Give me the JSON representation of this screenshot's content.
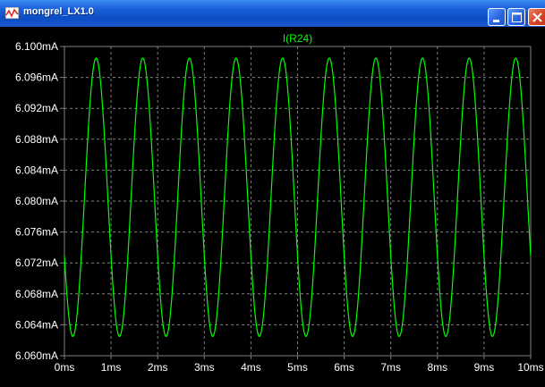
{
  "window": {
    "title": "mongrel_LX1.0",
    "icon": "waveform-icon",
    "buttons": {
      "minimize": "minimize-icon",
      "maximize": "maximize-icon",
      "close": "close-icon"
    }
  },
  "chart_data": {
    "type": "line",
    "title": "",
    "xlabel": "",
    "ylabel": "",
    "grid": true,
    "legend": "top-center",
    "background": "#000000",
    "grid_color": "#808080",
    "xlim": [
      0,
      10
    ],
    "ylim": [
      6.06,
      6.1
    ],
    "x_ticks": [
      0,
      1,
      2,
      3,
      4,
      5,
      6,
      7,
      8,
      9,
      10
    ],
    "x_tick_labels": [
      "0ms",
      "1ms",
      "2ms",
      "3ms",
      "4ms",
      "5ms",
      "6ms",
      "7ms",
      "8ms",
      "9ms",
      "10ms"
    ],
    "y_ticks": [
      6.06,
      6.064,
      6.068,
      6.072,
      6.076,
      6.08,
      6.084,
      6.088,
      6.092,
      6.096,
      6.1
    ],
    "y_tick_labels": [
      "6.060mA",
      "6.064mA",
      "6.068mA",
      "6.072mA",
      "6.076mA",
      "6.080mA",
      "6.084mA",
      "6.088mA",
      "6.092mA",
      "6.096mA",
      "6.100mA"
    ],
    "series": [
      {
        "name": "I(R24)",
        "color": "#00ff00",
        "x_unit": "ms",
        "y_unit": "mA",
        "waveform": "sine",
        "frequency_khz": 1.0,
        "offset": 6.0805,
        "amplitude": 0.018,
        "phase_deg": 205,
        "x_start": 0,
        "x_end": 10
      }
    ]
  }
}
